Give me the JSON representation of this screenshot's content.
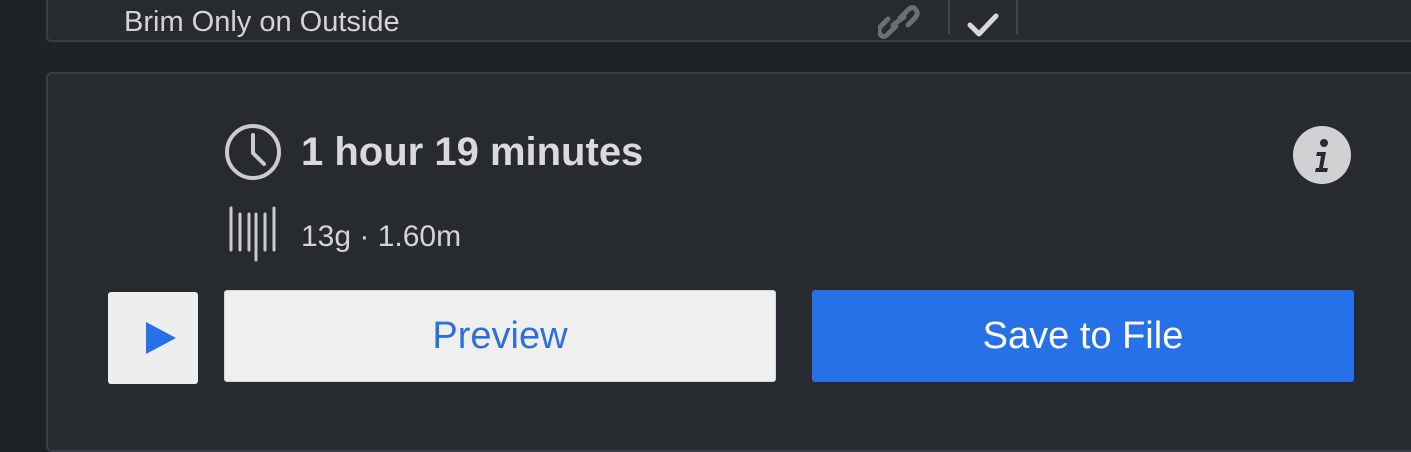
{
  "setting_row": {
    "label": "Brim Only on Outside"
  },
  "print_summary": {
    "print_time": "1 hour 19 minutes",
    "material_estimate": "13g · 1.60m"
  },
  "actions": {
    "preview_label": "Preview",
    "save_label": "Save to File"
  },
  "icons": {
    "link": "link-icon",
    "check": "check-icon",
    "clock": "clock-icon",
    "filament": "filament-spool-icon",
    "info": "info-icon",
    "play": "play-icon"
  },
  "colors": {
    "panel_bg": "#272b30",
    "page_bg": "#1f2226",
    "primary_button": "#2670e8",
    "secondary_button": "#efefef",
    "secondary_text": "#2f6fd8",
    "text": "#d8dadc"
  }
}
